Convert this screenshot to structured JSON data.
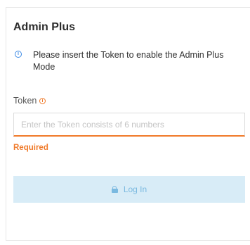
{
  "dialog": {
    "title": "Admin Plus",
    "info_message": "Please insert the Token to enable the Admin Plus Mode"
  },
  "token_field": {
    "label": "Token",
    "value": "",
    "placeholder": "Enter the Token consists of 6 numbers",
    "error": "Required"
  },
  "login_button": {
    "label": "Log In"
  },
  "icons": {
    "info": "info-circle-icon",
    "required": "alert-circle-icon",
    "lock": "lock-icon"
  },
  "colors": {
    "accent_blue": "#3d8be5",
    "error_orange": "#f07a2a",
    "button_disabled_bg": "#d8ecf7",
    "button_disabled_text": "#7ab9e0"
  }
}
